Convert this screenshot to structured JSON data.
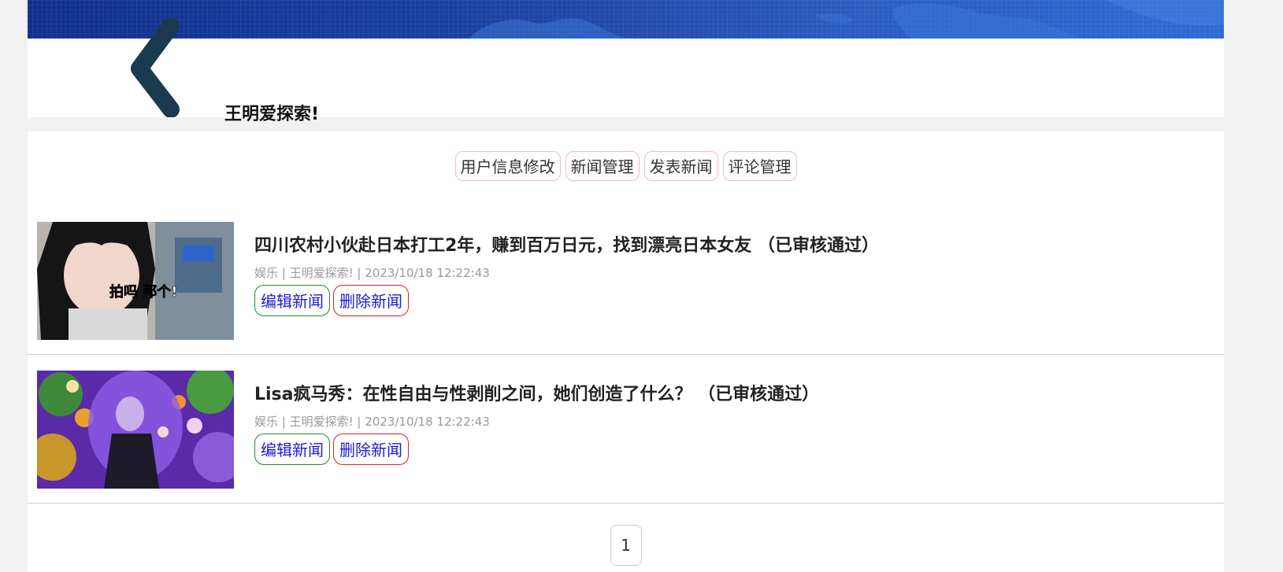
{
  "header": {
    "user_name": "王明爱探索!"
  },
  "nav": {
    "items": [
      {
        "label": "用户信息修改"
      },
      {
        "label": "新闻管理"
      },
      {
        "label": "发表新闻"
      },
      {
        "label": "评论管理"
      }
    ]
  },
  "news": [
    {
      "title": "四川农村小伙赴日本打工2年，赚到百万日元，找到漂亮日本女友 （已审核通过）",
      "meta": "娱乐 | 王明爱探索! | 2023/10/18 12:22:43",
      "thumb_caption": "拍吗 那个!",
      "edit_label": "编辑新闻",
      "delete_label": "删除新闻"
    },
    {
      "title": "Lisa疯马秀：在性自由与性剥削之间，她们创造了什么？ （已审核通过）",
      "meta": "娱乐 | 王明爱探索! | 2023/10/18 12:22:43",
      "edit_label": "编辑新闻",
      "delete_label": "删除新闻"
    }
  ],
  "pagination": {
    "current_page": "1"
  },
  "colors": {
    "banner": "#1a3f9e",
    "nav_border": "#f5b6cc",
    "edit_border": "#1f8a1f",
    "delete_border": "#e02020",
    "action_text": "#1b1bd6"
  }
}
